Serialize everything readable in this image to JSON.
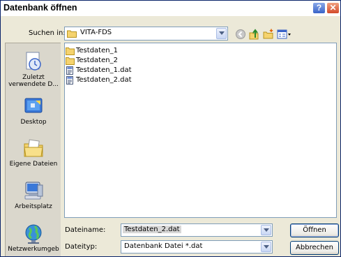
{
  "window": {
    "title": "Datenbank öffnen",
    "help_label": "?",
    "close_label": "✕"
  },
  "toolbar": {
    "look_in_label": "Suchen in:",
    "look_in_value": "VITA-FDS",
    "icons": [
      "back-icon",
      "up-folder-icon",
      "new-folder-icon",
      "view-menu-icon"
    ]
  },
  "places": [
    {
      "label": "Zuletzt",
      "label2": "verwendete D...",
      "icon": "recent-documents-icon"
    },
    {
      "label": "Desktop",
      "icon": "desktop-icon"
    },
    {
      "label": "Eigene Dateien",
      "icon": "my-documents-icon"
    },
    {
      "label": "Arbeitsplatz",
      "icon": "my-computer-icon"
    },
    {
      "label": "Netzwerkumgeb",
      "icon": "network-icon"
    }
  ],
  "files": [
    {
      "name": "Testdaten_1",
      "type": "folder"
    },
    {
      "name": "Testdaten_2",
      "type": "folder"
    },
    {
      "name": "Testdaten_1.dat",
      "type": "file"
    },
    {
      "name": "Testdaten_2.dat",
      "type": "file"
    }
  ],
  "form": {
    "filename_label": "Dateiname:",
    "filename_value": "Testdaten_2.dat",
    "filetype_label": "Dateityp:",
    "filetype_value": "Datenbank Datei *.dat"
  },
  "buttons": {
    "open": "Öffnen",
    "cancel": "Abbrechen"
  },
  "colors": {
    "titlebar": "#ffffff",
    "dialog_bg": "#ece9d8",
    "places_bg": "#dad7cc",
    "folder": "#f5d36e",
    "accent_border": "#7f9db9"
  }
}
